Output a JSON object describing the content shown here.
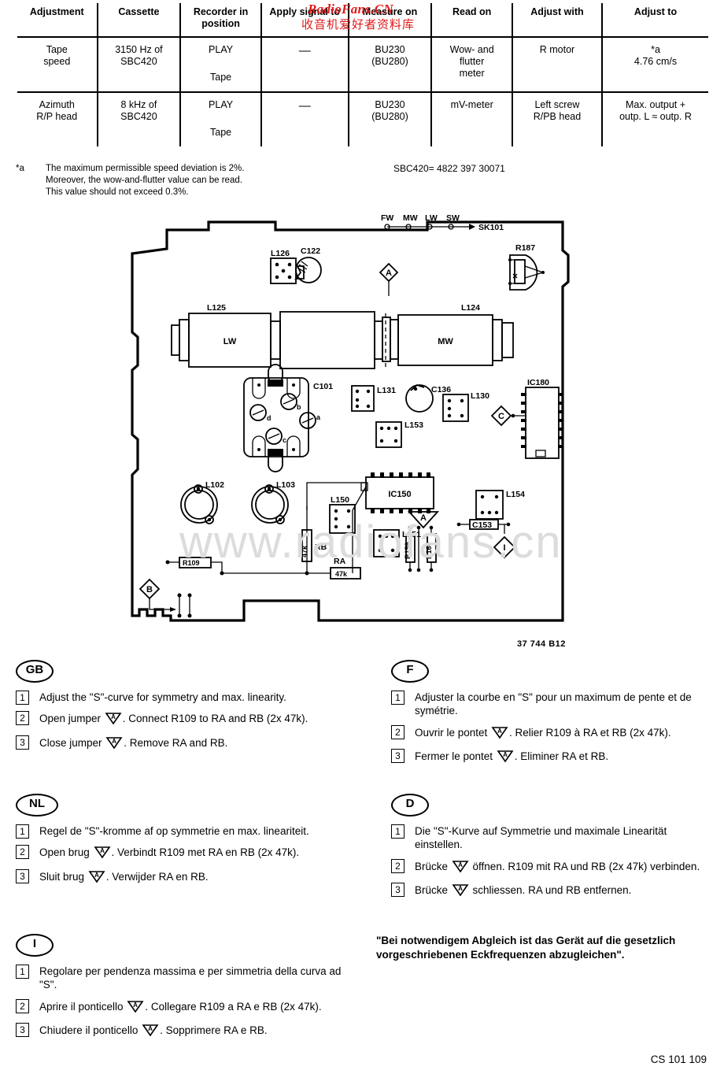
{
  "table": {
    "headers": [
      "Adjustment",
      "Cassette",
      "Recorder in position",
      "Apply signal to",
      "Measure on",
      "Read on",
      "Adjust with",
      "Adjust to"
    ],
    "rows": [
      {
        "adjustment": [
          "Tape",
          "speed"
        ],
        "cassette": [
          "3150 Hz of",
          "SBC420"
        ],
        "recorder_position": [
          "PLAY",
          "Tape"
        ],
        "apply_signal_to": [
          "—"
        ],
        "measure_on": [
          "BU230",
          "(BU280)"
        ],
        "read_on": [
          "Wow- and",
          "flutter",
          "meter"
        ],
        "adjust_with": [
          "R motor"
        ],
        "adjust_to": [
          "*a",
          "4.76 cm/s"
        ]
      },
      {
        "adjustment": [
          "Azimuth",
          "R/P head"
        ],
        "cassette": [
          "8 kHz of",
          "SBC420"
        ],
        "recorder_position": [
          "PLAY",
          "Tape"
        ],
        "apply_signal_to": [
          "—"
        ],
        "measure_on": [
          "BU230",
          "(BU280)"
        ],
        "read_on": [
          "mV-meter"
        ],
        "adjust_with": [
          "Left screw",
          "R/PB head"
        ],
        "adjust_to": [
          "Max. output +",
          "outp. L  ≈ outp. R"
        ]
      }
    ]
  },
  "footnote": {
    "marker": "*a",
    "lines": [
      "The maximum permissible speed deviation is 2%.",
      "Moreover, the wow-and-flutter value can be read.",
      "This value should not exceed 0.3%."
    ]
  },
  "sbc_code": "SBC420= 4822 397 30071",
  "pcb": {
    "switch_labels": [
      "FW",
      "MW",
      "LW",
      "SW"
    ],
    "switch_ref": "SK101",
    "drawing_number": "37 744 B12",
    "coils": [
      {
        "ref": "L125",
        "band": "LW"
      },
      {
        "ref": "L124",
        "band": "MW"
      }
    ],
    "components": [
      "L126",
      "C122",
      "R187",
      "C101",
      "L131",
      "C136",
      "L130",
      "L153",
      "IC180",
      "L102",
      "L103",
      "IC150",
      "L150",
      "L151",
      "L154",
      "C153",
      "R109",
      "R159",
      "R160"
    ],
    "tuning_trimmers": [
      "a",
      "b",
      "c",
      "d"
    ],
    "resistors": [
      {
        "ref": "RB",
        "value": "47k"
      },
      {
        "ref": "RA",
        "value": "47k"
      }
    ],
    "test_points": [
      "A",
      "A",
      "B",
      "C",
      "I"
    ]
  },
  "instructions": {
    "gb": {
      "badge": "GB",
      "steps": [
        {
          "num": "1",
          "parts": [
            {
              "t": "text",
              "v": "Adjust the \"S\"-curve for symmetry and max. linearity."
            }
          ]
        },
        {
          "num": "2",
          "parts": [
            {
              "t": "text",
              "v": "Open jumper "
            },
            {
              "t": "jumper",
              "v": "A"
            },
            {
              "t": "text",
              "v": ". Connect R109 to RA and RB (2x 47k)."
            }
          ]
        },
        {
          "num": "3",
          "parts": [
            {
              "t": "text",
              "v": "Close jumper "
            },
            {
              "t": "jumper",
              "v": "A"
            },
            {
              "t": "text",
              "v": ". Remove RA and RB."
            }
          ]
        }
      ]
    },
    "f": {
      "badge": "F",
      "steps": [
        {
          "num": "1",
          "parts": [
            {
              "t": "text",
              "v": "Adjuster la courbe en \"S\" pour un maximum de pente et de symétrie."
            }
          ]
        },
        {
          "num": "2",
          "parts": [
            {
              "t": "text",
              "v": "Ouvrir le pontet "
            },
            {
              "t": "jumper",
              "v": "A"
            },
            {
              "t": "text",
              "v": ". Relier R109 à RA et RB (2x 47k)."
            }
          ]
        },
        {
          "num": "3",
          "parts": [
            {
              "t": "text",
              "v": "Fermer le pontet "
            },
            {
              "t": "jumper",
              "v": "A"
            },
            {
              "t": "text",
              "v": ". Eliminer RA et RB."
            }
          ]
        }
      ]
    },
    "nl": {
      "badge": "NL",
      "steps": [
        {
          "num": "1",
          "parts": [
            {
              "t": "text",
              "v": "Regel de \"S\"-kromme af op symmetrie en max. lineariteit."
            }
          ]
        },
        {
          "num": "2",
          "parts": [
            {
              "t": "text",
              "v": "Open brug "
            },
            {
              "t": "jumper",
              "v": "A"
            },
            {
              "t": "text",
              "v": ". Verbindt R109 met RA en RB (2x 47k)."
            }
          ]
        },
        {
          "num": "3",
          "parts": [
            {
              "t": "text",
              "v": "Sluit brug "
            },
            {
              "t": "jumper",
              "v": "A"
            },
            {
              "t": "text",
              "v": ". Verwijder RA en RB."
            }
          ]
        }
      ]
    },
    "d": {
      "badge": "D",
      "steps": [
        {
          "num": "1",
          "parts": [
            {
              "t": "text",
              "v": "Die \"S\"-Kurve auf Symmetrie und maximale Linearität einstellen."
            }
          ]
        },
        {
          "num": "2",
          "parts": [
            {
              "t": "text",
              "v": "Brücke "
            },
            {
              "t": "jumper",
              "v": "A"
            },
            {
              "t": "text",
              "v": " öffnen. R109 mit RA und RB (2x 47k) verbinden."
            }
          ]
        },
        {
          "num": "3",
          "parts": [
            {
              "t": "text",
              "v": "Brücke "
            },
            {
              "t": "jumper",
              "v": "A"
            },
            {
              "t": "text",
              "v": " schliessen. RA und RB entfernen."
            }
          ]
        }
      ]
    },
    "i": {
      "badge": "I",
      "steps": [
        {
          "num": "1",
          "parts": [
            {
              "t": "text",
              "v": "Regolare per pendenza massima e per simmetria della curva ad \"S\"."
            }
          ]
        },
        {
          "num": "2",
          "parts": [
            {
              "t": "text",
              "v": "Aprire il ponticello "
            },
            {
              "t": "jumper",
              "v": "A"
            },
            {
              "t": "text",
              "v": ". Collegare R109 a RA e RB (2x 47k)."
            }
          ]
        },
        {
          "num": "3",
          "parts": [
            {
              "t": "text",
              "v": "Chiudere il ponticello "
            },
            {
              "t": "jumper",
              "v": "A"
            },
            {
              "t": "text",
              "v": ". Sopprimere RA e RB."
            }
          ]
        }
      ]
    }
  },
  "bold_note": "\"Bei notwendigem Abgleich ist das Gerät auf die gesetzlich vorgeschriebenen Eckfrequenzen abzugleichen\".",
  "page_code": "CS 101 109",
  "watermarks": {
    "red_latin": "RadioFans.CN",
    "red_chinese": "收音机爱好者资料库",
    "gray": "www.radiofans.cn",
    "red_color": "#e01b1b",
    "gray_color": "#dcdcdc"
  }
}
